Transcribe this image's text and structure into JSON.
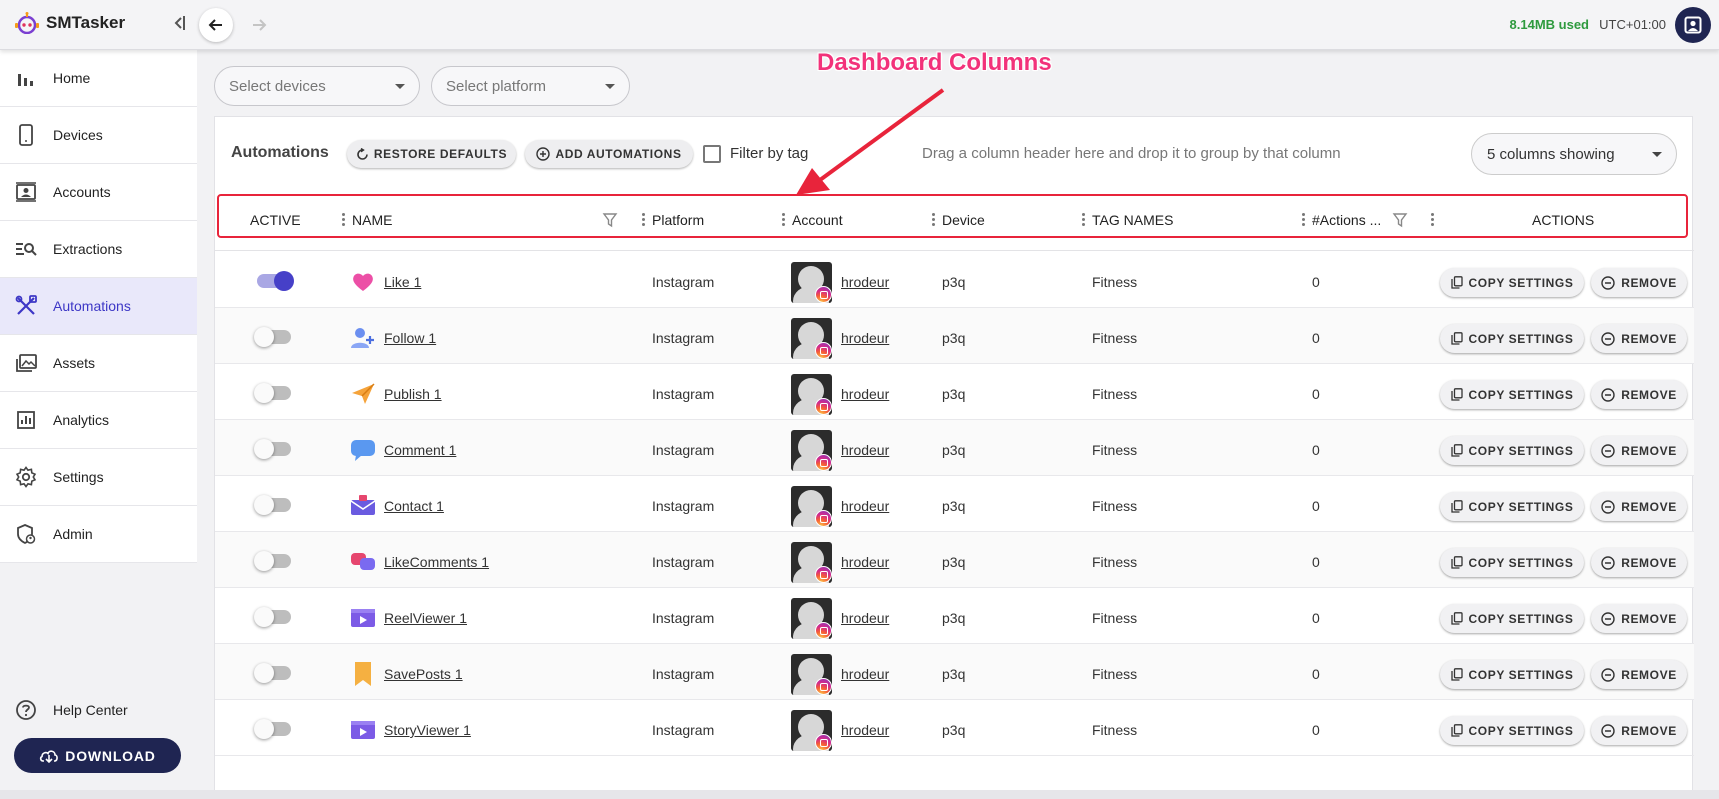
{
  "app": {
    "name": "SMTasker",
    "storage_used": "8.14MB used",
    "timezone": "UTC+01:00"
  },
  "sidebar": {
    "items": [
      {
        "label": "Home",
        "icon": "bar-chart-icon"
      },
      {
        "label": "Devices",
        "icon": "phone-icon"
      },
      {
        "label": "Accounts",
        "icon": "account-card-icon"
      },
      {
        "label": "Extractions",
        "icon": "search-list-icon"
      },
      {
        "label": "Automations",
        "icon": "tools-icon"
      },
      {
        "label": "Assets",
        "icon": "image-stack-icon"
      },
      {
        "label": "Analytics",
        "icon": "analytics-icon"
      },
      {
        "label": "Settings",
        "icon": "gear-icon"
      },
      {
        "label": "Admin",
        "icon": "shield-user-icon"
      }
    ],
    "active": "Automations",
    "help_label": "Help Center",
    "download_label": "DOWNLOAD"
  },
  "filters": {
    "devices_placeholder": "Select devices",
    "platform_placeholder": "Select platform"
  },
  "annotation": {
    "title": "Dashboard Columns"
  },
  "toolbar": {
    "title": "Automations",
    "restore_label": "RESTORE DEFAULTS",
    "add_label": "ADD AUTOMATIONS",
    "filter_tag_label": "Filter by tag",
    "group_hint": "Drag a column header here and drop it to group by that column",
    "columns_select": "5 columns showing"
  },
  "columns": {
    "active": "ACTIVE",
    "name": "NAME",
    "platform": "Platform",
    "account": "Account",
    "device": "Device",
    "tags": "TAG NAMES",
    "actions_count": "#Actions ...",
    "actions": "ACTIONS"
  },
  "row_buttons": {
    "copy": "COPY SETTINGS",
    "remove": "REMOVE"
  },
  "rows": [
    {
      "active": true,
      "name": "Like 1",
      "icon": "heart-icon",
      "platform": "Instagram",
      "account": "hrodeur",
      "device": "p3q",
      "tags": "Fitness",
      "actions": "0"
    },
    {
      "active": false,
      "name": "Follow 1",
      "icon": "add-user-icon",
      "platform": "Instagram",
      "account": "hrodeur",
      "device": "p3q",
      "tags": "Fitness",
      "actions": "0"
    },
    {
      "active": false,
      "name": "Publish 1",
      "icon": "paper-plane-icon",
      "platform": "Instagram",
      "account": "hrodeur",
      "device": "p3q",
      "tags": "Fitness",
      "actions": "0"
    },
    {
      "active": false,
      "name": "Comment 1",
      "icon": "speech-bubble-icon",
      "platform": "Instagram",
      "account": "hrodeur",
      "device": "p3q",
      "tags": "Fitness",
      "actions": "0"
    },
    {
      "active": false,
      "name": "Contact 1",
      "icon": "envelope-icon",
      "platform": "Instagram",
      "account": "hrodeur",
      "device": "p3q",
      "tags": "Fitness",
      "actions": "0"
    },
    {
      "active": false,
      "name": "LikeComments 1",
      "icon": "chat-hearts-icon",
      "platform": "Instagram",
      "account": "hrodeur",
      "device": "p3q",
      "tags": "Fitness",
      "actions": "0"
    },
    {
      "active": false,
      "name": "ReelViewer 1",
      "icon": "video-play-icon",
      "platform": "Instagram",
      "account": "hrodeur",
      "device": "p3q",
      "tags": "Fitness",
      "actions": "0"
    },
    {
      "active": false,
      "name": "SavePosts 1",
      "icon": "bookmark-icon",
      "platform": "Instagram",
      "account": "hrodeur",
      "device": "p3q",
      "tags": "Fitness",
      "actions": "0"
    },
    {
      "active": false,
      "name": "StoryViewer 1",
      "icon": "video-play-icon",
      "platform": "Instagram",
      "account": "hrodeur",
      "device": "p3q",
      "tags": "Fitness",
      "actions": "0"
    }
  ]
}
